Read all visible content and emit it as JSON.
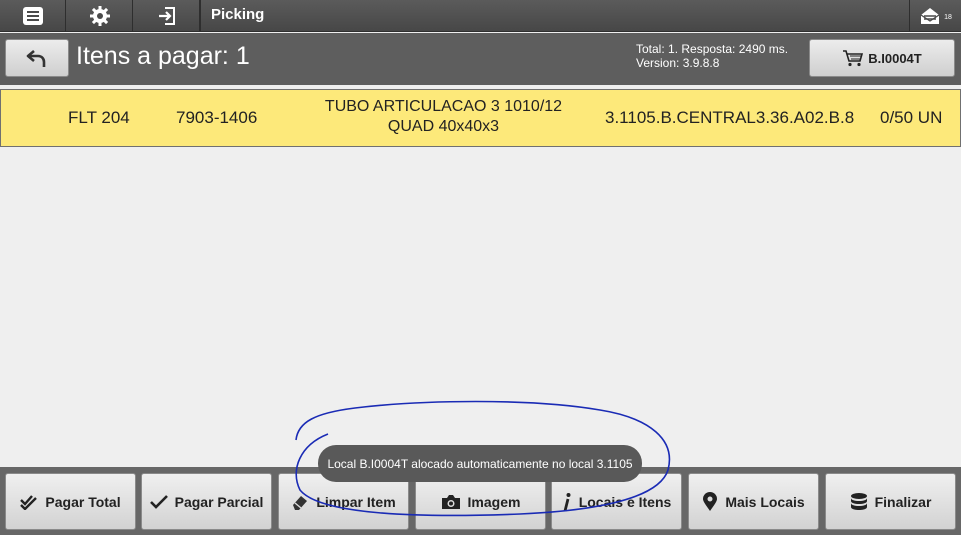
{
  "topbar": {
    "title": "Picking",
    "badge": "18",
    "icons": [
      "menu-icon",
      "gear-icon",
      "sign-in-icon",
      "mail-icon"
    ]
  },
  "subbar": {
    "title": "Itens a pagar: 1",
    "stats_total": "Total: 1. Resposta: 2490 ms.",
    "stats_version": "Version: 3.9.8.8",
    "cart_label": "B.I0004T"
  },
  "item": {
    "code": "FLT 204",
    "ref": "7903-1406",
    "desc_line1": "TUBO ARTICULACAO 3 1010/12",
    "desc_line2": "QUAD 40x40x3",
    "location": "3.1105.B.CENTRAL3.36.A02.B.8",
    "qty": "0/50 UN"
  },
  "toast": "Local B.I0004T alocado automaticamente no local 3.1105",
  "buttons": {
    "pagar_total": "Pagar Total",
    "pagar_parcial": "Pagar Parcial",
    "limpar_item": "Limpar Item",
    "imagem": "Imagem",
    "locais_itens": "Locais e Itens",
    "mais_locais": "Mais Locais",
    "finalizar": "Finalizar"
  },
  "colors": {
    "row_highlight": "#fde97a",
    "bar_dark": "#474747",
    "scribble": "#1a2bb5"
  }
}
